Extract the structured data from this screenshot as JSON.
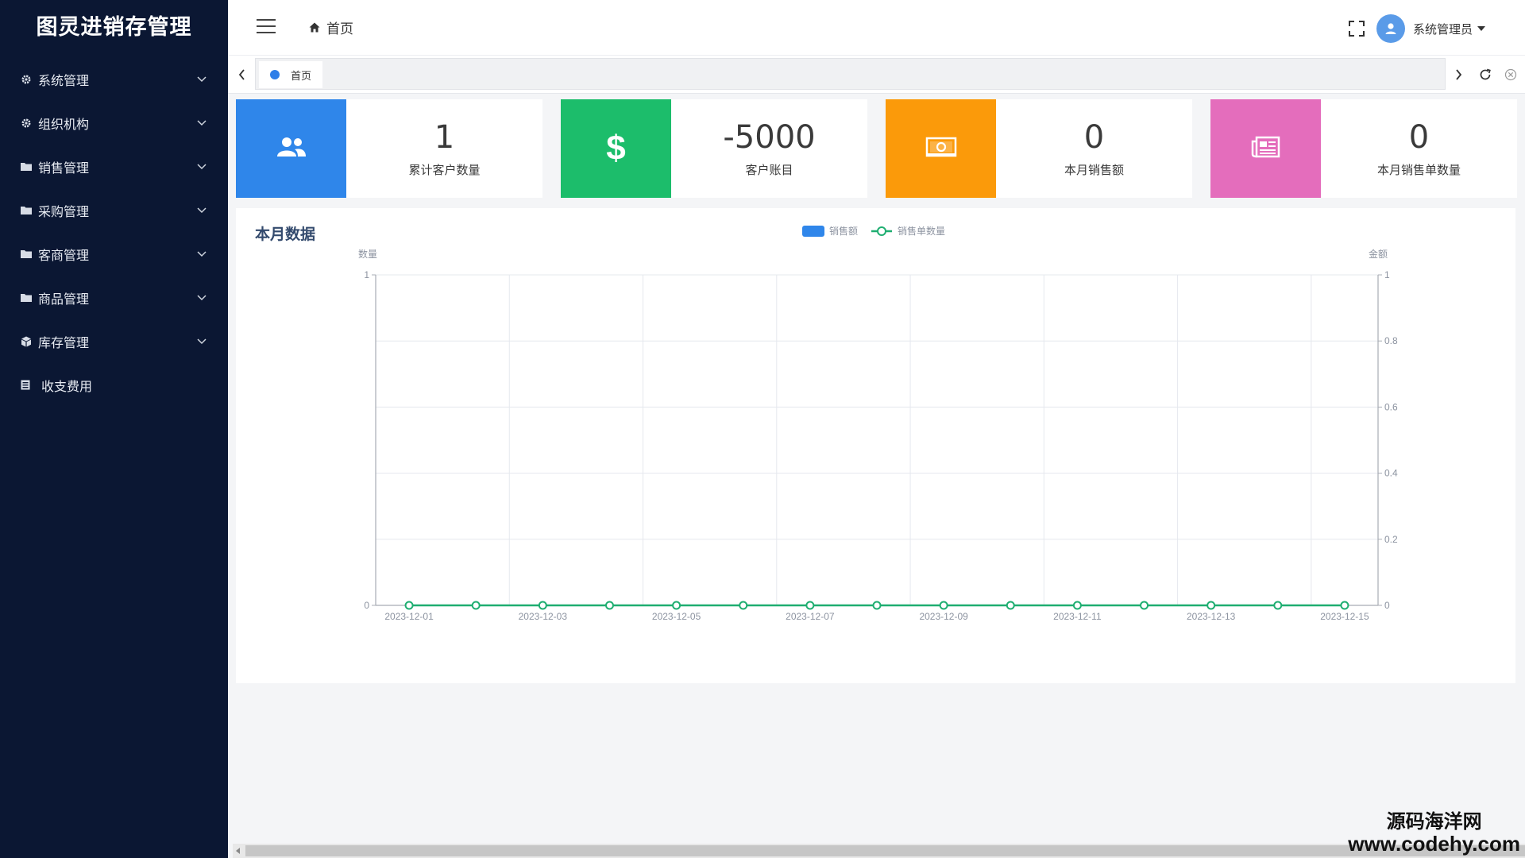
{
  "sidebar": {
    "brand": "图灵进销存管理",
    "items": [
      {
        "label": "系统管理",
        "icon": "gear-icon",
        "has_children": true
      },
      {
        "label": "组织机构",
        "icon": "gear-icon",
        "has_children": true
      },
      {
        "label": "销售管理",
        "icon": "folder-icon",
        "has_children": true
      },
      {
        "label": "采购管理",
        "icon": "folder-icon",
        "has_children": true
      },
      {
        "label": "客商管理",
        "icon": "folder-icon",
        "has_children": true
      },
      {
        "label": "商品管理",
        "icon": "folder-icon",
        "has_children": true
      },
      {
        "label": "库存管理",
        "icon": "cube-icon",
        "has_children": true
      },
      {
        "label": "收支费用",
        "icon": "document-icon",
        "has_children": false
      }
    ]
  },
  "header": {
    "breadcrumb": "首页",
    "user": "系统管理员"
  },
  "tabs": [
    {
      "label": "首页",
      "active": true
    }
  ],
  "cards": [
    {
      "value": "1",
      "label": "累计客户数量",
      "color": "#2f86ea",
      "icon": "users-icon"
    },
    {
      "value": "-5000",
      "label": "客户账目",
      "color": "#1cbd6b",
      "icon": "dollar-icon"
    },
    {
      "value": "0",
      "label": "本月销售额",
      "color": "#fb9a0a",
      "icon": "money-bill-icon"
    },
    {
      "value": "0",
      "label": "本月销售单数量",
      "color": "#e46dbc",
      "icon": "newspaper-icon"
    }
  ],
  "panel": {
    "title": "本月数据"
  },
  "chart_data": {
    "type": "line",
    "title": "",
    "legend": {
      "placement": "top-center",
      "items": [
        {
          "name": "销售额",
          "color": "#2f86ea",
          "kind": "bar"
        },
        {
          "name": "销售单数量",
          "color": "#1fae71",
          "kind": "line"
        }
      ]
    },
    "y_left_label": "数量",
    "y_right_label": "金额",
    "y_left_range": [
      0,
      1
    ],
    "y_left_ticks": [
      "0",
      "1"
    ],
    "y_right_range": [
      0,
      1
    ],
    "y_right_ticks": [
      "0",
      "0.2",
      "0.4",
      "0.6",
      "0.8",
      "1"
    ],
    "x_tick_labels": [
      "2023-12-01",
      "2023-12-03",
      "2023-12-05",
      "2023-12-07",
      "2023-12-09",
      "2023-12-11",
      "2023-12-13",
      "2023-12-15"
    ],
    "x": [
      "2023-12-01",
      "2023-12-02",
      "2023-12-03",
      "2023-12-04",
      "2023-12-05",
      "2023-12-06",
      "2023-12-07",
      "2023-12-08",
      "2023-12-09",
      "2023-12-10",
      "2023-12-11",
      "2023-12-12",
      "2023-12-13",
      "2023-12-14",
      "2023-12-15"
    ],
    "series": [
      {
        "name": "销售额",
        "values": [
          0,
          0,
          0,
          0,
          0,
          0,
          0,
          0,
          0,
          0,
          0,
          0,
          0,
          0,
          0
        ]
      },
      {
        "name": "销售单数量",
        "values": [
          0,
          0,
          0,
          0,
          0,
          0,
          0,
          0,
          0,
          0,
          0,
          0,
          0,
          0,
          0
        ]
      }
    ],
    "grid": true
  },
  "watermark": {
    "line1": "源码海洋网",
    "line2": "www.codehy.com"
  }
}
